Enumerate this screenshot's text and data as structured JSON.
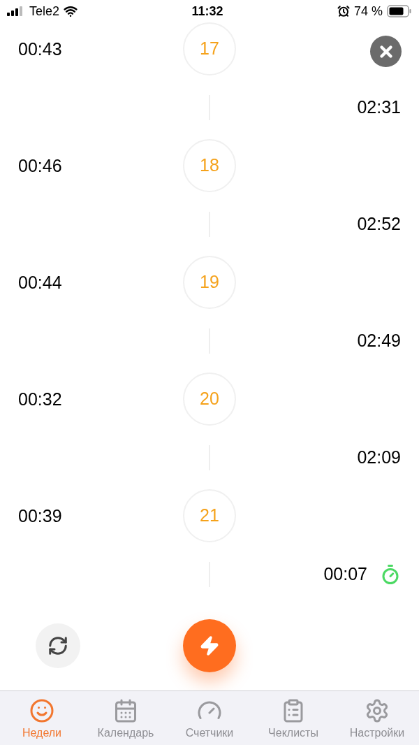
{
  "status_bar": {
    "carrier": "Tele2",
    "time": "11:32",
    "battery": "74 %"
  },
  "timeline": [
    {
      "kind": "contraction",
      "duration": "00:43",
      "number": "17"
    },
    {
      "kind": "interval",
      "duration": "02:31",
      "running": false
    },
    {
      "kind": "contraction",
      "duration": "00:46",
      "number": "18"
    },
    {
      "kind": "interval",
      "duration": "02:52",
      "running": false
    },
    {
      "kind": "contraction",
      "duration": "00:44",
      "number": "19"
    },
    {
      "kind": "interval",
      "duration": "02:49",
      "running": false
    },
    {
      "kind": "contraction",
      "duration": "00:32",
      "number": "20"
    },
    {
      "kind": "interval",
      "duration": "02:09",
      "running": false
    },
    {
      "kind": "contraction",
      "duration": "00:39",
      "number": "21"
    },
    {
      "kind": "interval",
      "duration": "00:07",
      "running": true
    }
  ],
  "tabs": [
    {
      "kind": "weeks",
      "label": "Недели",
      "selected": true
    },
    {
      "kind": "calendar",
      "label": "Календарь",
      "selected": false
    },
    {
      "kind": "counters",
      "label": "Счетчики",
      "selected": false
    },
    {
      "kind": "checklists",
      "label": "Чеклисты",
      "selected": false
    },
    {
      "kind": "settings",
      "label": "Настройки",
      "selected": false
    }
  ]
}
